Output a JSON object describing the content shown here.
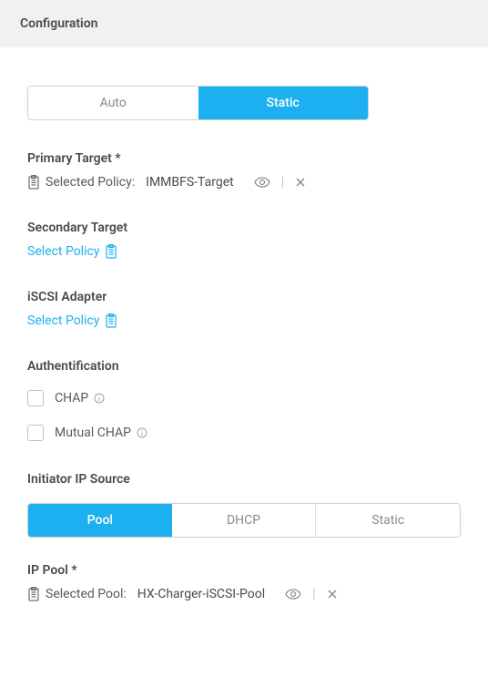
{
  "header": {
    "title": "Configuration"
  },
  "targetType": {
    "options": [
      "Auto",
      "Static"
    ],
    "selected": "Static"
  },
  "primaryTarget": {
    "label": "Primary Target *",
    "selectedLabel": "Selected Policy:",
    "value": "IMMBFS-Target"
  },
  "secondaryTarget": {
    "label": "Secondary Target",
    "action": "Select Policy"
  },
  "iscsiAdapter": {
    "label": "iSCSI Adapter",
    "action": "Select Policy"
  },
  "authentication": {
    "label": "Authentification",
    "chap": "CHAP",
    "mutualChap": "Mutual CHAP"
  },
  "initiator": {
    "label": "Initiator IP Source",
    "options": [
      "Pool",
      "DHCP",
      "Static"
    ],
    "selected": "Pool"
  },
  "ipPool": {
    "label": "IP Pool *",
    "selectedLabel": "Selected Pool:",
    "value": "HX-Charger-iSCSI-Pool"
  }
}
